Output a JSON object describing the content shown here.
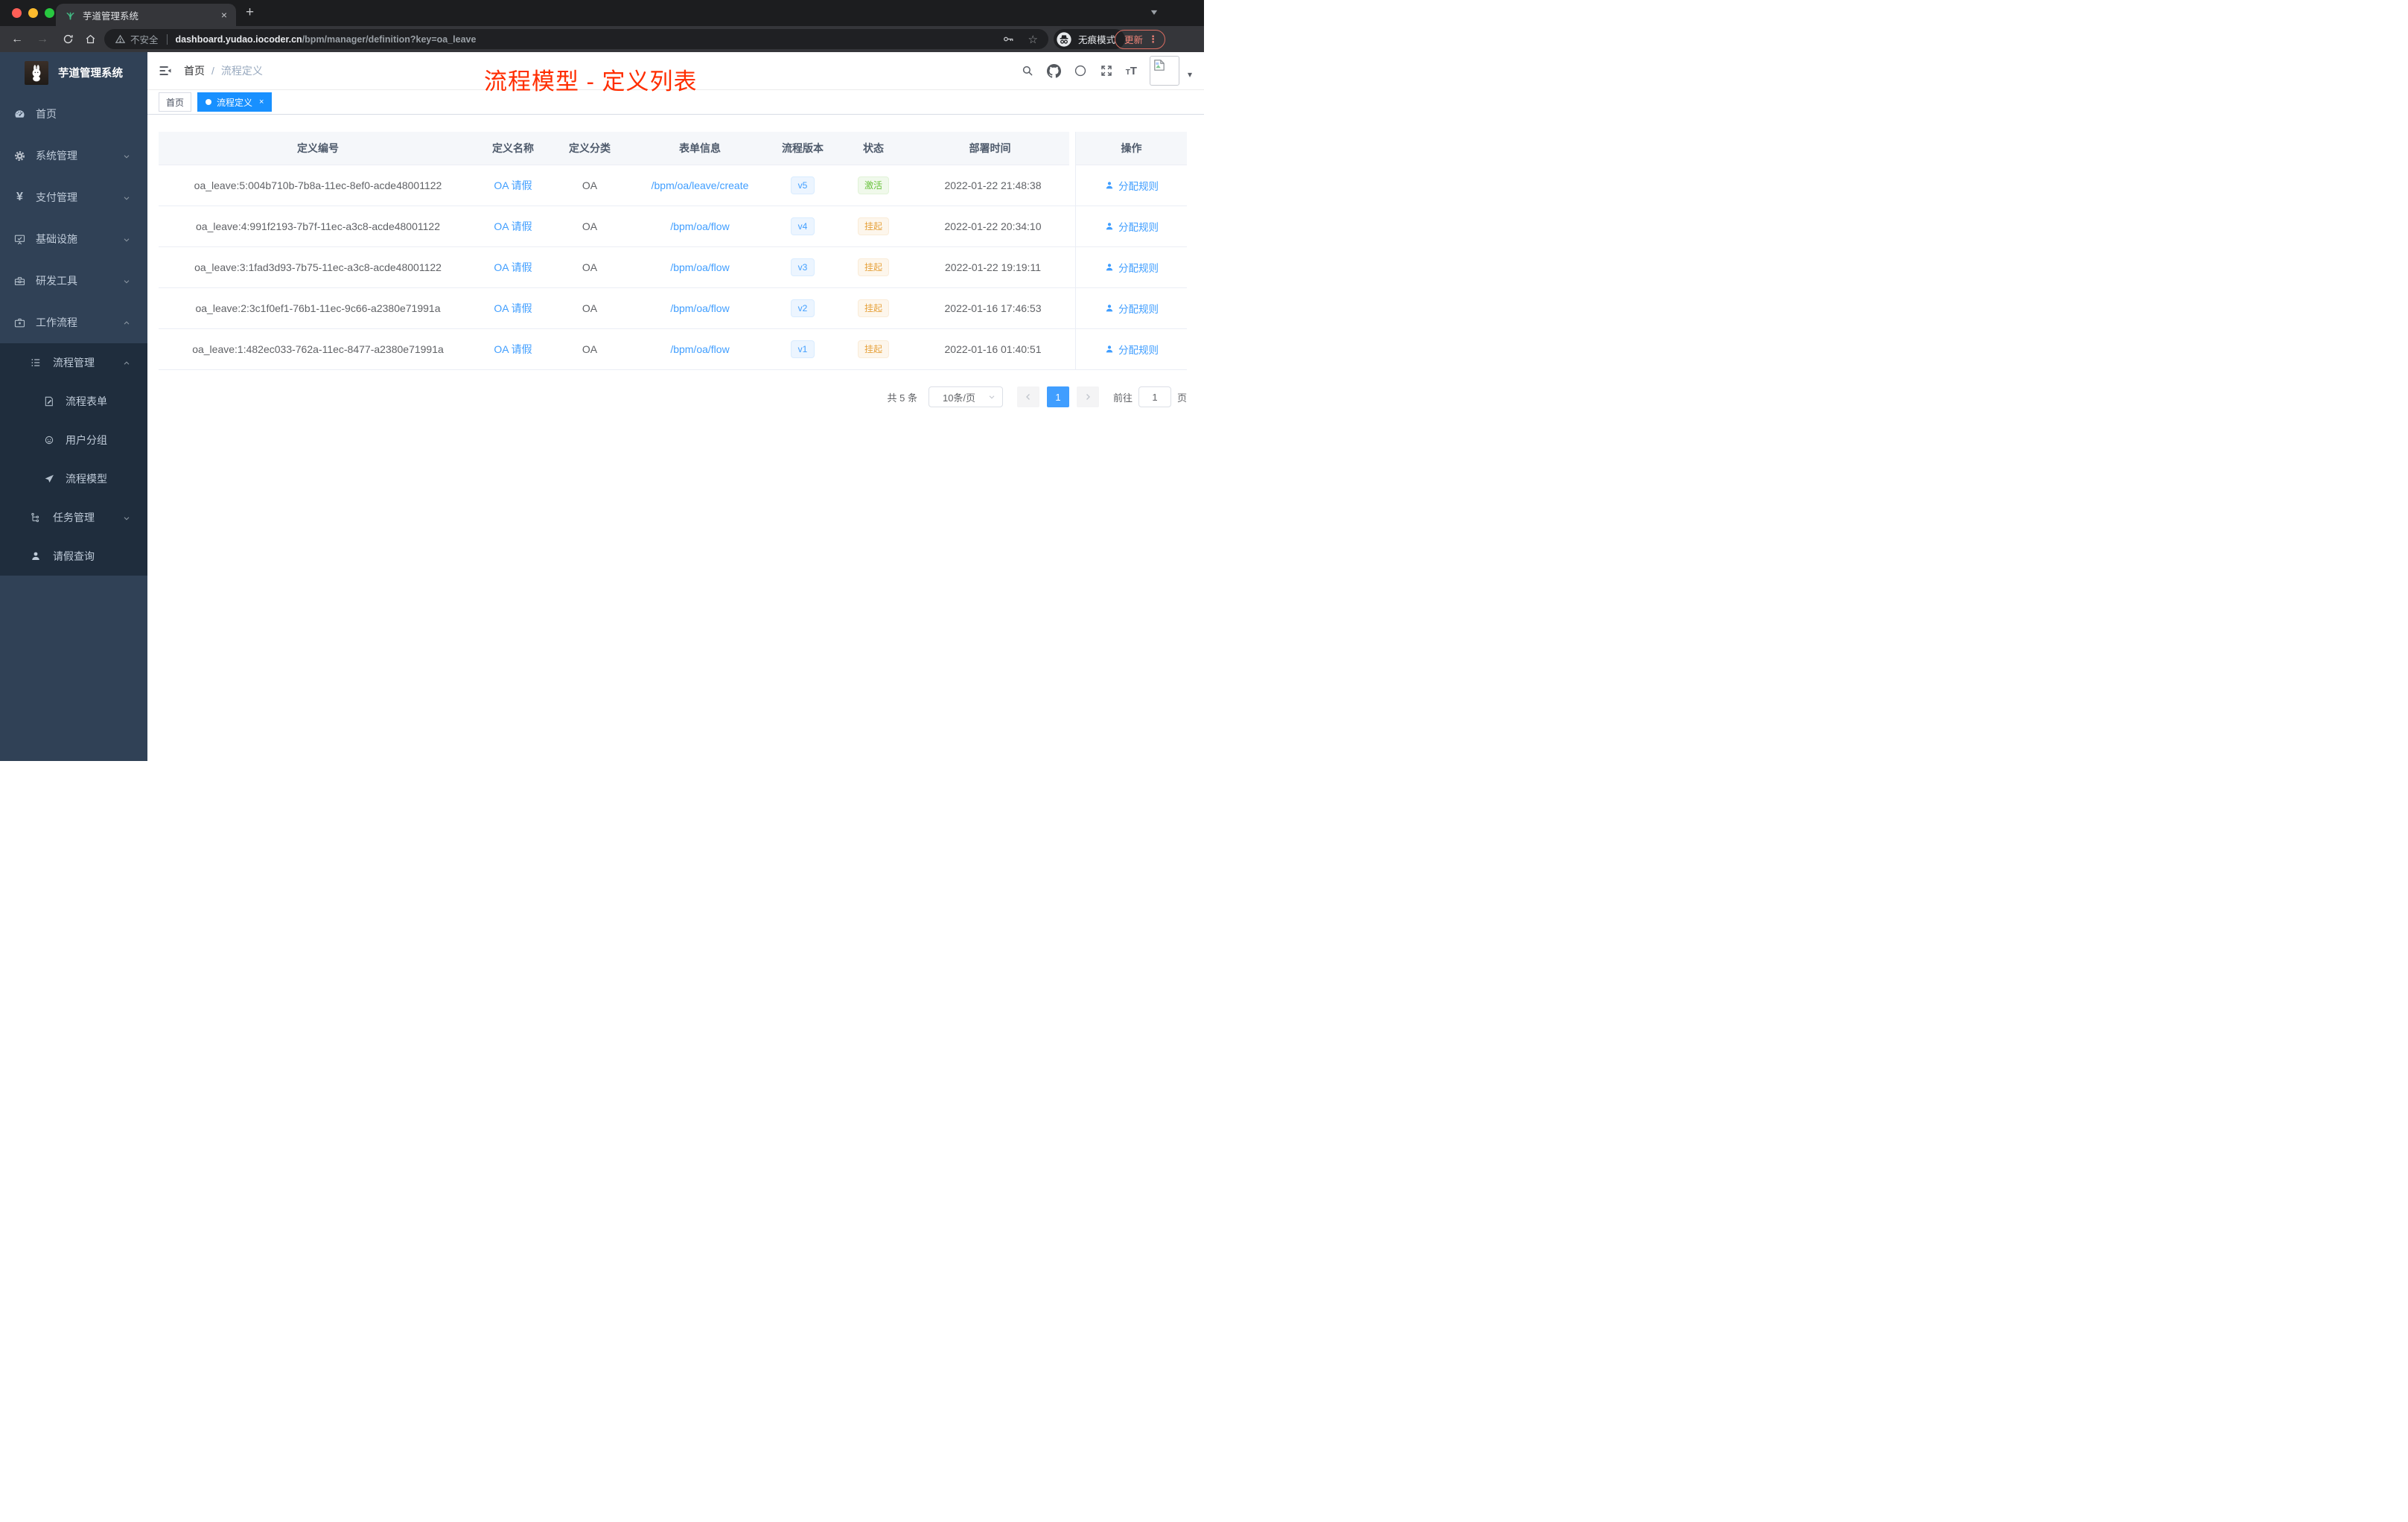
{
  "browser": {
    "tab_title": "芋道管理系统",
    "url": {
      "warning_label": "不安全",
      "host": "dashboard.yudao.iocoder.cn",
      "path": "/bpm/manager/definition?key=oa_leave"
    },
    "incognito_label": "无痕模式",
    "update_label": "更新"
  },
  "sidebar": {
    "app_title": "芋道管理系统",
    "items": [
      {
        "label": "首页"
      },
      {
        "label": "系统管理"
      },
      {
        "label": "支付管理"
      },
      {
        "label": "基础设施"
      },
      {
        "label": "研发工具"
      },
      {
        "label": "工作流程"
      },
      {
        "label": "流程管理"
      },
      {
        "label": "流程表单"
      },
      {
        "label": "用户分组"
      },
      {
        "label": "流程模型"
      },
      {
        "label": "任务管理"
      },
      {
        "label": "请假查询"
      }
    ]
  },
  "header": {
    "breadcrumb": {
      "root": "首页",
      "separator": "/",
      "current": "流程定义"
    },
    "overlay_title": "流程模型 - 定义列表"
  },
  "tags": {
    "home": "首页",
    "active": "流程定义"
  },
  "table": {
    "columns": [
      "定义编号",
      "定义名称",
      "定义分类",
      "表单信息",
      "流程版本",
      "状态",
      "部署时间"
    ],
    "action_column": "操作",
    "action_label": "分配规则",
    "rows": [
      {
        "id": "oa_leave:5:004b710b-7b8a-11ec-8ef0-acde48001122",
        "name": "OA 请假",
        "category": "OA",
        "form": "/bpm/oa/leave/create",
        "version": "v5",
        "status": "激活",
        "time": "2022-01-22 21:48:38"
      },
      {
        "id": "oa_leave:4:991f2193-7b7f-11ec-a3c8-acde48001122",
        "name": "OA 请假",
        "category": "OA",
        "form": "/bpm/oa/flow",
        "version": "v4",
        "status": "挂起",
        "time": "2022-01-22 20:34:10"
      },
      {
        "id": "oa_leave:3:1fad3d93-7b75-11ec-a3c8-acde48001122",
        "name": "OA 请假",
        "category": "OA",
        "form": "/bpm/oa/flow",
        "version": "v3",
        "status": "挂起",
        "time": "2022-01-22 19:19:11"
      },
      {
        "id": "oa_leave:2:3c1f0ef1-76b1-11ec-9c66-a2380e71991a",
        "name": "OA 请假",
        "category": "OA",
        "form": "/bpm/oa/flow",
        "version": "v2",
        "status": "挂起",
        "time": "2022-01-16 17:46:53"
      },
      {
        "id": "oa_leave:1:482ec033-762a-11ec-8477-a2380e71991a",
        "name": "OA 请假",
        "category": "OA",
        "form": "/bpm/oa/flow",
        "version": "v1",
        "status": "挂起",
        "time": "2022-01-16 01:40:51"
      }
    ]
  },
  "pagination": {
    "total": "共 5 条",
    "page_size": "10条/页",
    "current_page": "1",
    "goto_label": "前往",
    "goto_value": "1",
    "page_unit": "页"
  },
  "glyphs": {
    "close": "×",
    "plus": "+",
    "caret_down": "▾",
    "star": "☆",
    "back": "←",
    "forward": "→",
    "dots": "⋮",
    "yen": "¥",
    "font_small": "T",
    "font_big": "T"
  },
  "colors": {
    "accent_blue": "#409eff",
    "tag_active_blue": "#1890ff",
    "overlay_red": "#ff2d00",
    "sidebar_bg": "#304156",
    "submenu_bg": "#1f2d3d",
    "status_active_green": "#67c23a",
    "status_suspend_orange": "#e6a23c",
    "update_button_red": "#f08478"
  }
}
